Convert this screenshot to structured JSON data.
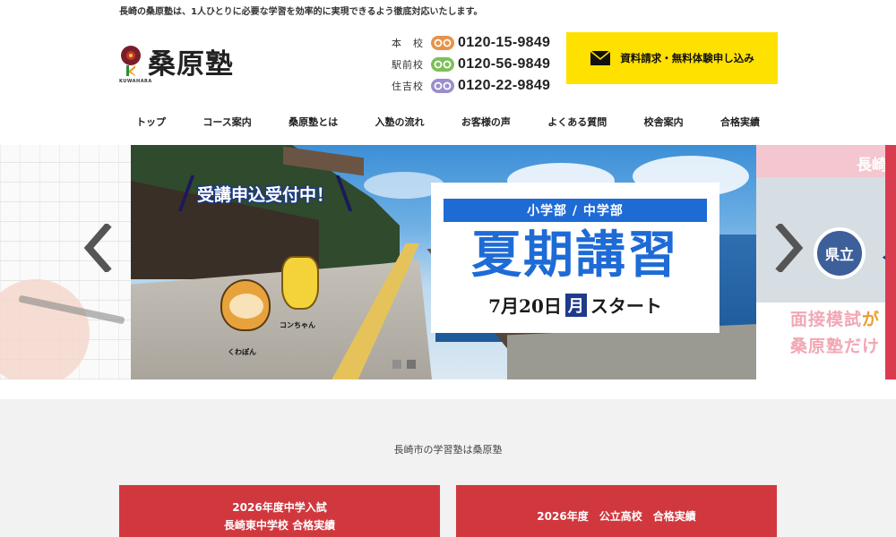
{
  "header": {
    "tagline": "長崎の桑原塾は、1人ひとりに必要な学習を効率的に実現できるよう徹底対応いたします。",
    "logo_text": "桑原塾",
    "logo_en": "KUWAHARA"
  },
  "phones": [
    {
      "school": "本　校",
      "number": "0120-15-9849",
      "color": "#e8924a"
    },
    {
      "school": "駅前校",
      "number": "0120-56-9849",
      "color": "#7cbf5a"
    },
    {
      "school": "住吉校",
      "number": "0120-22-9849",
      "color": "#9a8ecb"
    }
  ],
  "cta": {
    "label": "資料請求・無料体験申し込み",
    "color": "#ffe100"
  },
  "nav": [
    "トップ",
    "コース案内",
    "桑原塾とは",
    "入塾の流れ",
    "お客様の声",
    "よくある質問",
    "校舎案内",
    "合格実績"
  ],
  "slider": {
    "enroll_text": "受講申込受付中！",
    "band": "小学部 / 中学部",
    "headline": "夏期講習",
    "date_pre": "7月20日",
    "date_box": "月",
    "date_post": "スタート",
    "char_left": "くわぽん",
    "char_right": "コンちゃん",
    "slide_count": 2,
    "active_index": 0
  },
  "side_slide": {
    "top_text": "長崎",
    "circle_text": "県立",
    "big_char": "県",
    "line1_a": "面接模試",
    "line1_b": "が",
    "line2_a": "桑原塾だけ",
    "line2_b": ""
  },
  "section": {
    "subtitle": "長崎市の学習塾は桑原塾",
    "results": [
      {
        "line1": "2026年度中学入試",
        "line2": "長崎東中学校 合格実績"
      },
      {
        "line1": "2026年度　公立高校　合格実績",
        "line2": ""
      }
    ]
  }
}
